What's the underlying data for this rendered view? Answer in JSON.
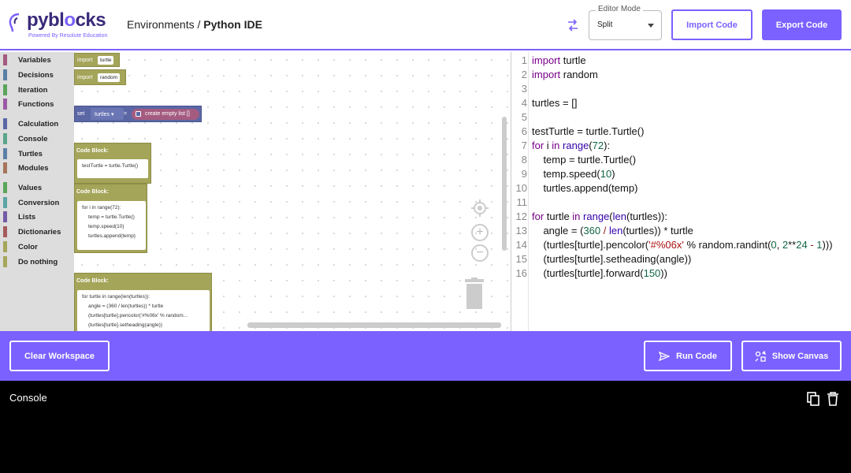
{
  "header": {
    "logo": {
      "text_main": "pybl",
      "text_accent": "cks",
      "o_glyph": "o",
      "tagline": "Powered By Resolute Education"
    },
    "breadcrumb": {
      "parent": "Environments",
      "separator": "/",
      "current": "Python IDE"
    },
    "editor_mode": {
      "label": "Editor Mode",
      "value": "Split"
    },
    "import_label": "Import Code",
    "export_label": "Export Code"
  },
  "toolbox": {
    "items": [
      {
        "label": "Variables",
        "color": "#a55b80"
      },
      {
        "label": "Decisions",
        "color": "#5b80a5"
      },
      {
        "label": "Iteration",
        "color": "#5ba55b"
      },
      {
        "label": "Functions",
        "color": "#995ba5"
      },
      {
        "label": "Calculation",
        "color": "#5b67a5"
      },
      {
        "label": "Console",
        "color": "#5ba58c"
      },
      {
        "label": "Turtles",
        "color": "#5b80a5"
      },
      {
        "label": "Modules",
        "color": "#a5745b"
      },
      {
        "label": "Values",
        "color": "#5ba55b"
      },
      {
        "label": "Conversion",
        "color": "#5ba5a5"
      },
      {
        "label": "Lists",
        "color": "#745ba5"
      },
      {
        "label": "Dictionaries",
        "color": "#a55b5b"
      },
      {
        "label": "Color",
        "color": "#a5a55b"
      },
      {
        "label": "Do nothing",
        "color": "#a5a55b"
      }
    ]
  },
  "workspace": {
    "import1": {
      "kw": "import",
      "module": "turtle"
    },
    "import2": {
      "kw": "import",
      "module": "random"
    },
    "set_block": {
      "kw": "set",
      "var": "turtles ▾",
      "eq": "=",
      "value": "create empty list []"
    },
    "code_block_label": "Code Block:",
    "block1": [
      "testTurtle = turtle.Turtle()"
    ],
    "block2": [
      "for i in range(72):",
      "temp = turtle.Turtle()",
      "temp.speed(10)",
      "turtles.append(temp)"
    ],
    "block3": [
      "for turtle in range(len(turtles)):",
      "angle = (360 / len(turtles)) * turtle",
      "(turtles[turtle].pencolor('#%06x' % random...",
      "(turtles[turtle].setheading(angle))"
    ]
  },
  "editor": {
    "line_numbers": [
      "1",
      "2",
      "3",
      "4",
      "5",
      "6",
      "7",
      "8",
      "9",
      "10",
      "11",
      "12",
      "13",
      "14",
      "15",
      "16"
    ]
  },
  "actions": {
    "clear_label": "Clear Workspace",
    "run_label": "Run Code",
    "canvas_label": "Show Canvas"
  },
  "console": {
    "title": "Console"
  },
  "colors": {
    "accent": "#7b61ff",
    "block_olive": "#a5a55a",
    "block_blue": "#5b67a5"
  }
}
